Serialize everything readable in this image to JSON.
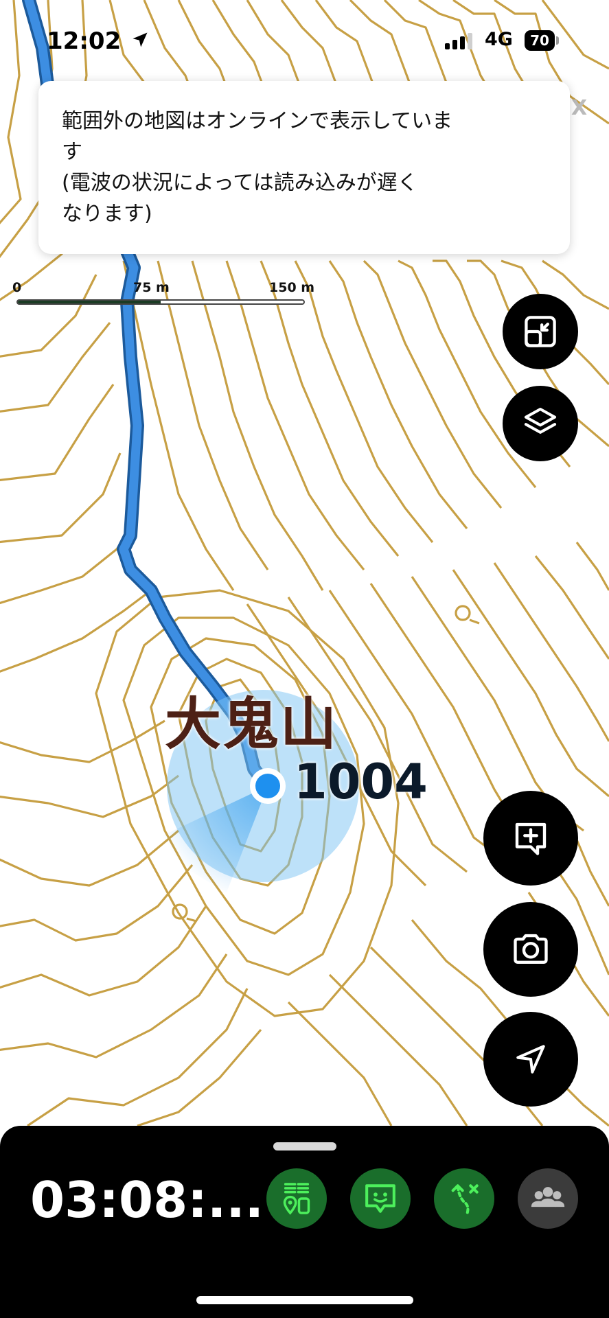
{
  "status_bar": {
    "time": "12:02",
    "network": "4G",
    "battery": "70"
  },
  "notice": {
    "text": "範囲外の地図はオンラインで表示していま\nす\n(電波の状況によっては読み込みが遅く\nなります)"
  },
  "close_label": "X",
  "scale_bar": {
    "labels": [
      "0",
      "75 m",
      "150 m"
    ]
  },
  "map": {
    "peak_name": "大鬼山",
    "elevation": "1004"
  },
  "controls": {
    "icons": [
      "shrink-icon",
      "layers-icon",
      "add-memo-icon",
      "camera-icon",
      "navigation-arrow-icon"
    ]
  },
  "bottom_panel": {
    "elapsed_time": "03:08:...",
    "actions": [
      "hiking-status-icon",
      "message-icon",
      "route-icon",
      "group-icon"
    ]
  },
  "colors": {
    "contour": "#c7a045",
    "route": "#3d8ee2",
    "accent_green": "#1a6e2b",
    "icon_green": "#4df05c"
  }
}
